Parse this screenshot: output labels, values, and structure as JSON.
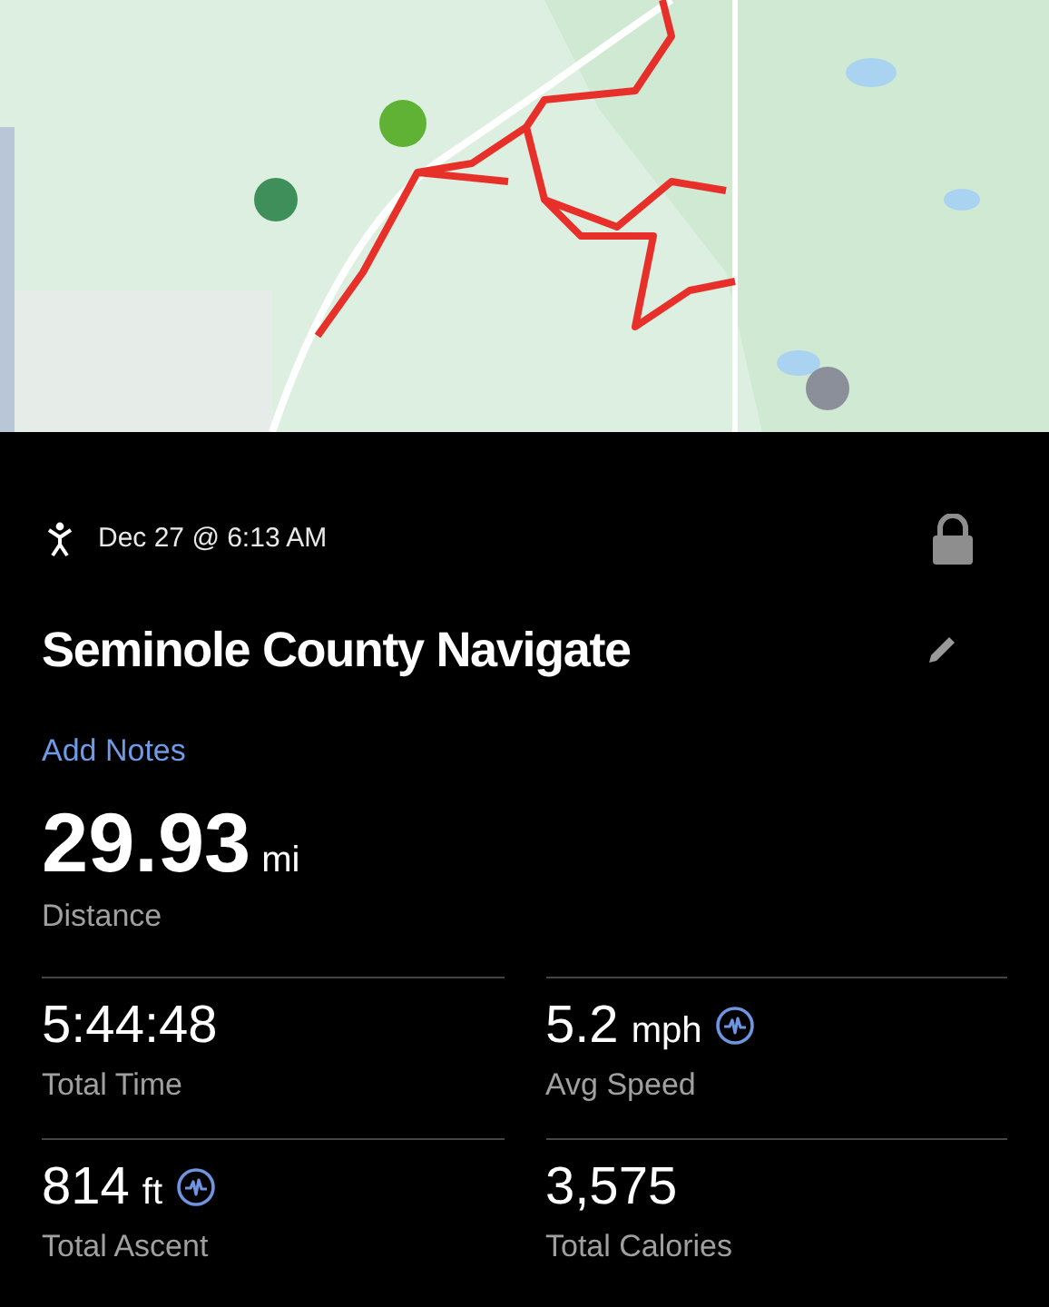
{
  "activity": {
    "date": "Dec 27 @ 6:13 AM",
    "locked": true
  },
  "title": "Seminole County Navigate",
  "add_notes": "Add Notes",
  "distance": {
    "value": "29.93",
    "unit": "mi",
    "label": "Distance"
  },
  "stats": [
    {
      "value": "5:44:48",
      "label": "Total Time",
      "chart": false
    },
    {
      "value": "5.2",
      "unit": "mph",
      "label": "Avg Speed",
      "chart": true
    },
    {
      "value": "814",
      "unit": "ft",
      "label": "Total Ascent",
      "chart": true
    },
    {
      "value": "3,575",
      "label": "Total Calories",
      "chart": false
    }
  ]
}
